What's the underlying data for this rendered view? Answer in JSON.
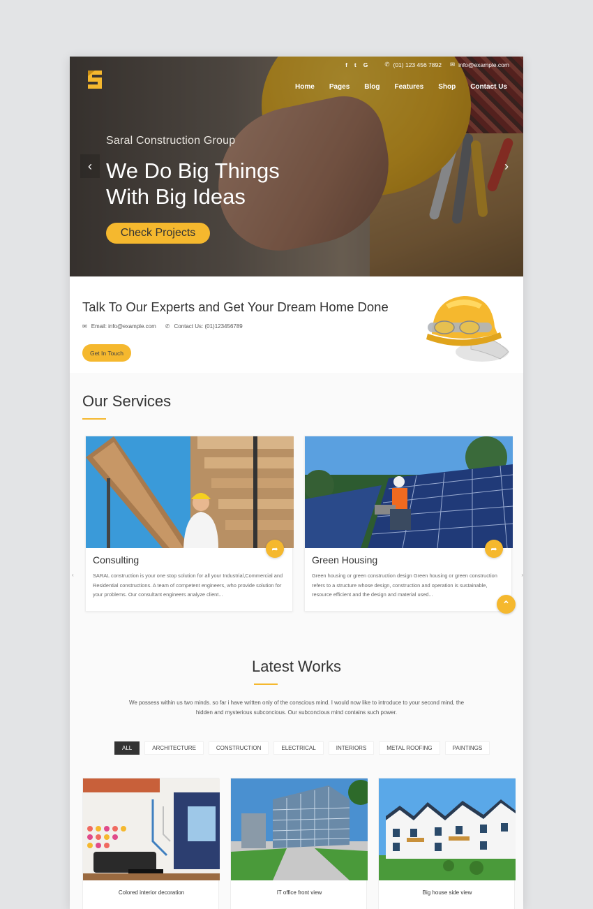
{
  "header": {
    "social": [
      "f",
      "t",
      "G"
    ],
    "phone": "(01) 123 456 7892",
    "email": "info@example.com",
    "nav": [
      "Home",
      "Pages",
      "Blog",
      "Features",
      "Shop",
      "Contact Us"
    ]
  },
  "hero": {
    "subtitle": "Saral Construction Group",
    "title_line1": "We Do Big Things",
    "title_line2": "With Big Ideas",
    "button": "Check Projects",
    "prev_arrow": "‹",
    "next_arrow": "›"
  },
  "experts": {
    "title": "Talk To Our Experts and Get Your Dream Home Done",
    "email_text": "Email: info@example.com",
    "contact_text": "Contact Us: (01)123456789",
    "button": "Get In Touch"
  },
  "services": {
    "title": "Our Services",
    "cards": [
      {
        "title": "Consulting",
        "text": "SARAL construction  is your one stop solution for all your Industrial,Commercial and Residential constructions. A team  of  competent engineers, who provide solution for your problems. Our consultant engineers  analyze client..."
      },
      {
        "title": "Green Housing",
        "text": "Green housing or green construction design Green housing or green construction refers to a structure whose design, construction and operation is sustainable, resource efficient and the design and material used..."
      }
    ]
  },
  "works": {
    "title": "Latest Works",
    "description": "We possess within us two minds. so far i have written only of the conscious mind. I would now like to introduce to your second mind, the hidden and mysterious subconcious. Our subconcious mind contains such power.",
    "filters": [
      "ALL",
      "ARCHITECTURE",
      "CONSTRUCTION",
      "ELECTRICAL",
      "INTERIORS",
      "METAL ROOFING",
      "PAINTINGS"
    ],
    "items": [
      {
        "caption": "Colored interior decoration"
      },
      {
        "caption": "IT office front view"
      },
      {
        "caption": "Big house side view"
      }
    ]
  },
  "colors": {
    "accent": "#f5b82e",
    "dark": "#333333"
  }
}
